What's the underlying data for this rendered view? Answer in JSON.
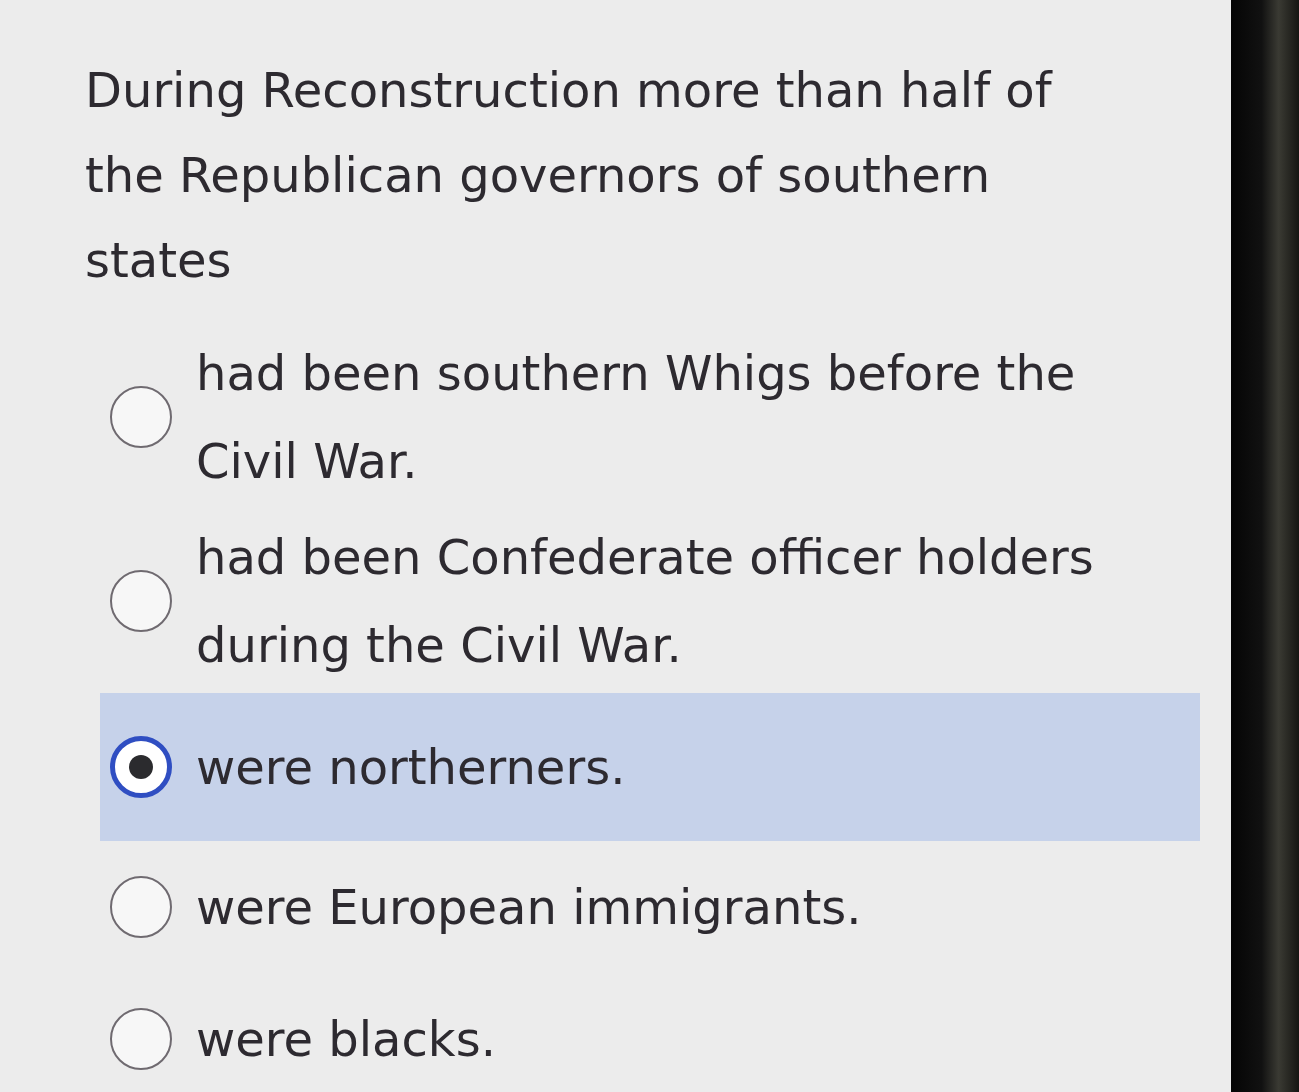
{
  "question": "During Reconstruction more than half of the Republican governors of southern states",
  "options": [
    {
      "label": "had been southern Whigs before the Civil War.",
      "selected": false
    },
    {
      "label": "had been Confederate officer holders during the Civil War.",
      "selected": false
    },
    {
      "label": "were northerners.",
      "selected": true
    },
    {
      "label": "were European immigrants.",
      "selected": false
    },
    {
      "label": "were blacks.",
      "selected": false
    }
  ]
}
